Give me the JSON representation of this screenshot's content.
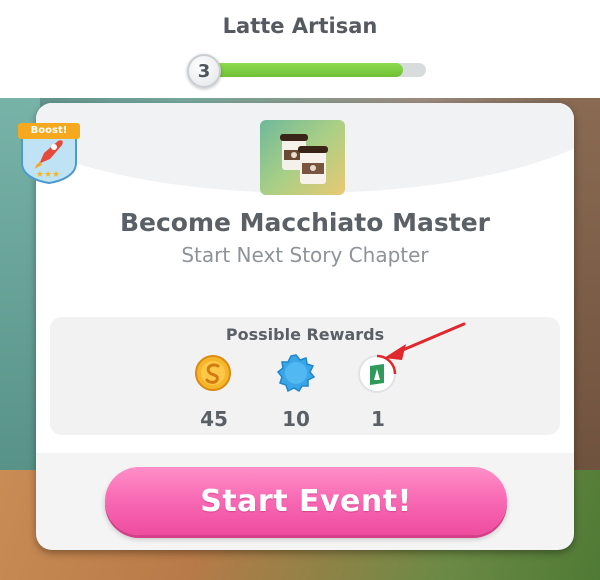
{
  "header": {
    "career_title": "Latte Artisan",
    "level": "3",
    "level_progress": 0.9
  },
  "boost": {
    "label": "Boost!",
    "stars": "★★★"
  },
  "event": {
    "title": "Become Macchiato Master",
    "subtitle": "Start Next Story Chapter",
    "image_icon": "coffee-cups-icon"
  },
  "rewards": {
    "header": "Possible Rewards",
    "items": [
      {
        "icon": "simoleon-coin-icon",
        "value": "45",
        "color": "#f2a51a"
      },
      {
        "icon": "xp-badge-icon",
        "value": "10",
        "color": "#3aa6e8"
      },
      {
        "icon": "career-token-icon",
        "value": "1",
        "color": "#2f9a5a"
      }
    ]
  },
  "action": {
    "start_label": "Start Event!"
  },
  "colors": {
    "start_button": "#f868b3",
    "progress_fill": "#7cc93f",
    "annotation": "#e0282d"
  }
}
